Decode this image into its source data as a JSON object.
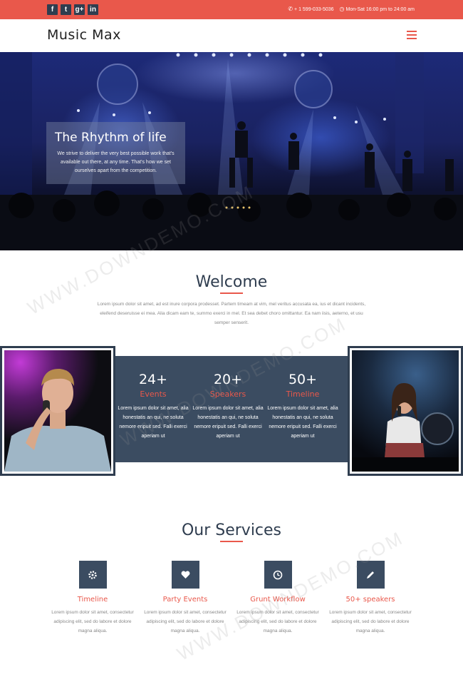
{
  "topbar": {
    "social": [
      {
        "icon": "facebook-icon",
        "glyph": "f"
      },
      {
        "icon": "twitter-icon",
        "glyph": "t"
      },
      {
        "icon": "google-plus-icon",
        "glyph": "g+"
      },
      {
        "icon": "linkedin-icon",
        "glyph": "in"
      }
    ],
    "phone": "+ 1 599-033-5036",
    "hours": "Mon-Sat 16:00 pm to 24:00 am"
  },
  "header": {
    "logo": "Music Max",
    "menu_icon": "hamburger-menu-icon"
  },
  "hero": {
    "title": "The Rhythm of life",
    "text": "We strive to deliver the very best possible work that's available out there, at any time. That's how we set ourselves apart from the competition."
  },
  "welcome": {
    "title": "Welcome",
    "text": "Lorem ipsum dolor sit amet, ad est inure corpora prodesset. Partem timeam at vim, mel veritus accusata ea, ius et dicant incidents, eleifend deseruisse ei mea. Alia dicam eam te, summo exerci in mel. Et sea debet choro omittantur. Ea nam iisis, aeterno, et usu semper senserit."
  },
  "stats": [
    {
      "number": "24+",
      "label": "Events",
      "text": "Lorem ipsum dolor sit amet, alia honestatis an qui, ne soluta nemore eripuit sed. Falli exerci aperiam ut"
    },
    {
      "number": "20+",
      "label": "Speakers",
      "text": "Lorem ipsum dolor sit amet, alia honestatis an qui, ne soluta nemore eripuit sed. Falli exerci aperiam ut"
    },
    {
      "number": "50+",
      "label": "Timeline",
      "text": "Lorem ipsum dolor sit amet, alia honestatis an qui, ne soluta nemore eripuit sed. Falli exerci aperiam ut"
    }
  ],
  "services": {
    "title": "Our Services",
    "items": [
      {
        "icon": "gear-icon",
        "title": "Timeline",
        "text": "Lorem ipsum dolor sit amet, consectetur adipiscing elit, sed do labore et dolore magna aliqua."
      },
      {
        "icon": "heart-icon",
        "title": "Party Events",
        "text": "Lorem ipsum dolor sit amet, consectetur adipiscing elit, sed do labore et dolore magna aliqua."
      },
      {
        "icon": "clock-icon",
        "title": "Grunt Workflow",
        "text": "Lorem ipsum dolor sit amet, consectetur adipiscing elit, sed do labore et dolore magna aliqua."
      },
      {
        "icon": "pencil-icon",
        "title": "50+ speakers",
        "text": "Lorem ipsum dolor sit amet, consectetur adipiscing elit, sed do labore et dolore magna aliqua."
      }
    ]
  },
  "watermark": "WWW.DOWNDEMO.COM",
  "colors": {
    "accent": "#e9584b",
    "dark": "#2f3d4f",
    "band": "#3b4c61"
  }
}
